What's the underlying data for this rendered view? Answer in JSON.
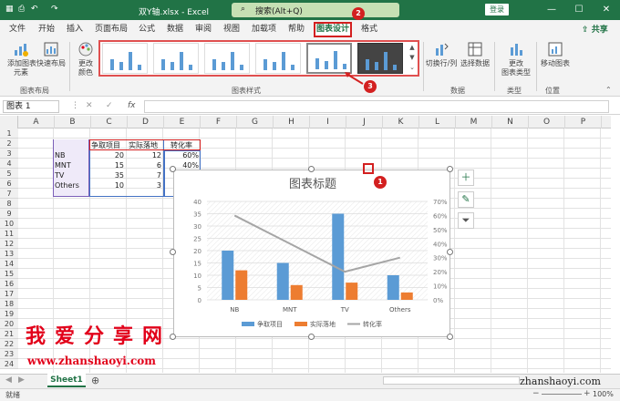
{
  "titlebar": {
    "filename": "双Y轴.xlsx",
    "app": "Excel",
    "search": "搜索(Alt+Q)",
    "login": "登录"
  },
  "tabs": [
    "文件",
    "开始",
    "插入",
    "页面布局",
    "公式",
    "数据",
    "审阅",
    "视图",
    "加载项",
    "帮助",
    "图表设计",
    "格式"
  ],
  "share": "共享",
  "ribbon": {
    "add_element": "添加图表\n元素",
    "quick_layout": "快速布局",
    "change_colors": "更改\n颜色",
    "switch_row_col": "切换行/列",
    "select_data": "选择数据",
    "change_type": "更改\n图表类型",
    "move_chart": "移动图表",
    "groups": {
      "layouts": "图表布局",
      "styles": "图表样式",
      "data": "数据",
      "type": "类型",
      "location": "位置"
    }
  },
  "formula_bar": {
    "namebox": "图表 1",
    "fx": "fx"
  },
  "columns": [
    "A",
    "B",
    "C",
    "D",
    "E",
    "F",
    "G",
    "H",
    "I",
    "J",
    "K",
    "L",
    "M",
    "N",
    "O",
    "P"
  ],
  "rows": [
    "1",
    "2",
    "3",
    "4",
    "5",
    "6",
    "7",
    "8",
    "9",
    "10",
    "11",
    "12",
    "13",
    "14",
    "15",
    "16",
    "17",
    "18",
    "19",
    "20",
    "21",
    "22",
    "23",
    "24"
  ],
  "table": {
    "headers": [
      "争取项目",
      "实际落地",
      "转化率"
    ],
    "rows": [
      [
        "NB",
        "20",
        "12",
        "60%"
      ],
      [
        "MNT",
        "15",
        "6",
        "40%"
      ],
      [
        "TV",
        "35",
        "7",
        "20%"
      ],
      [
        "Others",
        "10",
        "3",
        "30%"
      ]
    ]
  },
  "chart_data": {
    "type": "bar",
    "title": "图表标题",
    "categories": [
      "NB",
      "MNT",
      "TV",
      "Others"
    ],
    "series": [
      {
        "name": "争取项目",
        "values": [
          20,
          15,
          35,
          10
        ],
        "color": "#5b9bd5",
        "axis": "left",
        "kind": "bar"
      },
      {
        "name": "实际落地",
        "values": [
          12,
          6,
          7,
          3
        ],
        "color": "#ed7d31",
        "axis": "left",
        "kind": "bar"
      },
      {
        "name": "转化率",
        "values": [
          0.6,
          0.4,
          0.2,
          0.3
        ],
        "color": "#a5a5a5",
        "axis": "right",
        "kind": "line"
      }
    ],
    "ylim": [
      0,
      40
    ],
    "yticks": [
      "0",
      "5",
      "10",
      "15",
      "20",
      "25",
      "30",
      "35",
      "40"
    ],
    "y2lim": [
      0,
      0.7
    ],
    "y2ticks": [
      "0%",
      "10%",
      "20%",
      "30%",
      "40%",
      "50%",
      "60%",
      "70%"
    ],
    "legend": "bottom",
    "grid": true
  },
  "sheet": {
    "tab": "Sheet1"
  },
  "status": {
    "ready": "就绪",
    "zoom": "100%"
  },
  "watermark": {
    "cn": "我爱分享网",
    "url": "www.zhanshaoyi.com",
    "url2": "zhanshaoyi.com"
  },
  "markers": [
    "1",
    "2",
    "3"
  ],
  "colors": {
    "excel_green": "#217346",
    "marker_red": "#d32020"
  }
}
